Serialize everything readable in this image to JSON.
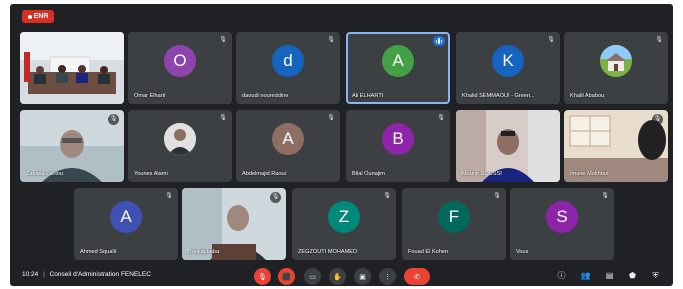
{
  "recording": {
    "label": "ENR"
  },
  "participants": [
    {
      "id": "room",
      "name": "",
      "video": "room"
    },
    {
      "id": "omar",
      "name": "Omar Elharti",
      "initial": "O",
      "color": "#8e44ad"
    },
    {
      "id": "daoudi",
      "name": "daoudi noureddine",
      "initial": "d",
      "color": "#1565c0"
    },
    {
      "id": "ali",
      "name": "Ali ELHARTI",
      "initial": "A",
      "color": "#43a047"
    },
    {
      "id": "khalid",
      "name": "Khalid SEMMAOUI - Green...",
      "initial": "K",
      "color": "#1565c0"
    },
    {
      "id": "khalil",
      "name": "Khalil Ababou",
      "initial": "",
      "color": "#6d8b5e"
    },
    {
      "id": "man1",
      "name": "Zakaria Lahlou",
      "video": "man"
    },
    {
      "id": "younes",
      "name": "Younes Alami",
      "video": "photo"
    },
    {
      "id": "abdel",
      "name": "Abdelmajid Raoui",
      "initial": "A",
      "color": "#8d6e63"
    },
    {
      "id": "bilal",
      "name": "Bilal Ounajim",
      "initial": "B",
      "color": "#8e24aa"
    },
    {
      "id": "mounir",
      "name": "Mounir SOUSSI",
      "video": "man2"
    },
    {
      "id": "imane",
      "name": "Imane Mokhtari",
      "video": "office"
    },
    {
      "id": "ahmed",
      "name": "Ahmed Squalli",
      "initial": "A",
      "color": "#3f51b5"
    },
    {
      "id": "boukachaba",
      "name": "Boukachaba",
      "video": "man3"
    },
    {
      "id": "zeg",
      "name": "ZEGZOUTI MOHAMED",
      "initial": "Z",
      "color": "#00897b"
    },
    {
      "id": "fouad",
      "name": "Fouad El Kohen",
      "initial": "F",
      "color": "#00695c"
    },
    {
      "id": "vous",
      "name": "Vous",
      "initial": "S",
      "color": "#8e24aa"
    }
  ],
  "bottom_bar": {
    "time": "10:24",
    "separator": "|",
    "meeting_title": "Conseil d'Administration FENELEC"
  },
  "icons": {
    "mic_off": "🎙",
    "cam_off": "⬛",
    "captions": "▭",
    "hand": "✋",
    "present": "▣",
    "more": "⋮",
    "end": "✆",
    "info": "ⓘ",
    "people": "👥",
    "chat": "▤",
    "activities": "⬟",
    "security": "⛨"
  }
}
